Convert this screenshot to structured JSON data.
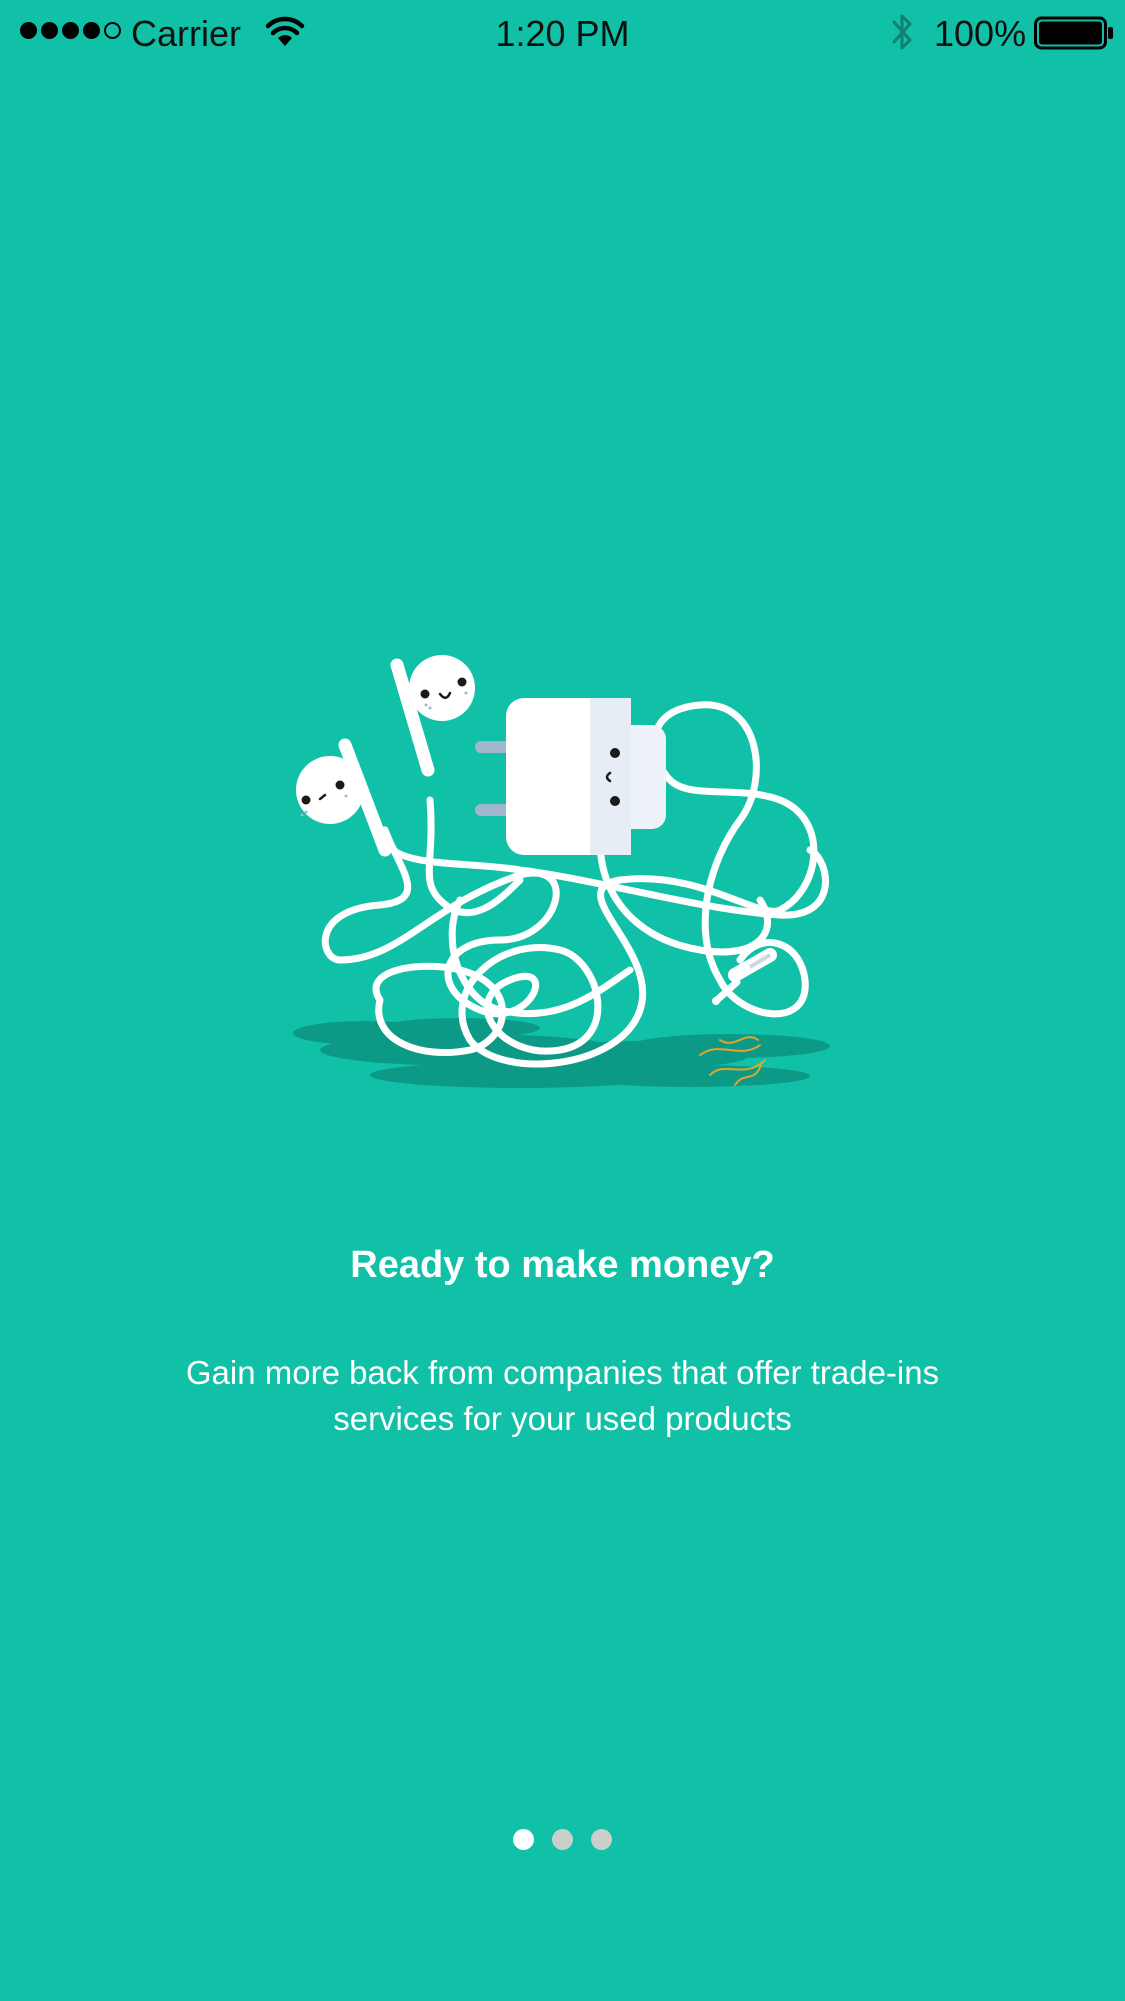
{
  "status_bar": {
    "carrier": "Carrier",
    "time": "1:20 PM",
    "battery_percent": "100%",
    "signal_bars_filled": 4,
    "signal_bars_total": 5,
    "icons": [
      "wifi-icon",
      "bluetooth-icon",
      "battery-icon"
    ]
  },
  "onboarding": {
    "title": "Ready to make money?",
    "description": "Gain more back from companies that offer trade-ins services for your used products",
    "illustration": "tangled-earphones-and-charger-illustration"
  },
  "pagination": {
    "total_pages": 3,
    "current_page": 1
  },
  "colors": {
    "background": "#10C1A8",
    "text": "#FFFFFF",
    "indicator_active": "#FFFFFF",
    "indicator_inactive": "#C9CFCB"
  }
}
